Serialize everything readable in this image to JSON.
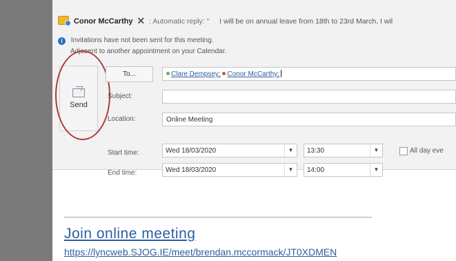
{
  "info_bar": {
    "sender": "Conor McCarthy",
    "auto_reply_label": ": Automatic reply: \"",
    "auto_reply_message": "I will be on annual leave from 18th to 23rd March, I wil",
    "notice_line1": "Invitations have not been sent for this meeting.",
    "notice_line2": "Adjacent to another appointment on your Calendar."
  },
  "actions": {
    "send_label": "Send",
    "to_label": "To..."
  },
  "fields": {
    "subject_label": "Subject:",
    "location_label": "Location:",
    "start_label": "Start time:",
    "end_label": "End time:",
    "subject_value": "",
    "location_value": "Online Meeting",
    "recipients": [
      "Clare Dempsey;",
      "Conor McCarthy;"
    ],
    "recipient_status_colors": [
      "#5cb85c",
      "#d9534f"
    ]
  },
  "times": {
    "start_date": "Wed 18/03/2020",
    "start_time": "13:30",
    "end_date": "Wed 18/03/2020",
    "end_time": "14:00",
    "all_day_label": "All day eve",
    "all_day_checked": false
  },
  "body": {
    "join_link_text": "Join online meeting",
    "url_text": "https://lyncweb.SJOG.IE/meet/brendan.mccormack/JT0XDMEN"
  },
  "colors": {
    "link": "#2b5ea3",
    "annotation_circle": "#b23a3a"
  }
}
